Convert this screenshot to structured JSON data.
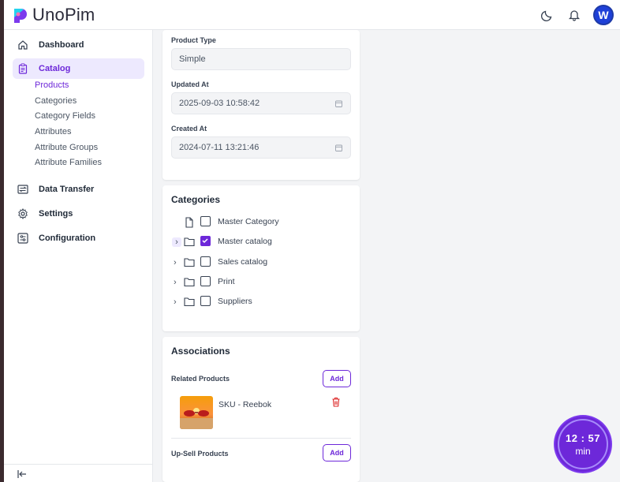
{
  "app": {
    "name": "UnoPim"
  },
  "header": {
    "avatar_letter": "W",
    "avatar_color": "#1e40d8"
  },
  "sidebar": {
    "items": [
      {
        "label": "Dashboard",
        "icon": "home-icon"
      },
      {
        "label": "Catalog",
        "icon": "clipboard-icon",
        "active": true
      },
      {
        "label": "Data Transfer",
        "icon": "transfer-icon"
      },
      {
        "label": "Settings",
        "icon": "gear-icon"
      },
      {
        "label": "Configuration",
        "icon": "sliders-icon"
      }
    ],
    "catalog_sub": [
      "Products",
      "Categories",
      "Category Fields",
      "Attributes",
      "Attribute Groups",
      "Attribute Families"
    ],
    "active_sub": "Products"
  },
  "general": {
    "product_type_label": "Product Type",
    "product_type_value": "Simple",
    "updated_at_label": "Updated At",
    "updated_at_value": "2025-09-03 10:58:42",
    "created_at_label": "Created At",
    "created_at_value": "2024-07-11 13:21:46"
  },
  "categories": {
    "title": "Categories",
    "items": [
      {
        "label": "Master Category",
        "type": "file",
        "expandable": false,
        "checked": false
      },
      {
        "label": "Master catalog",
        "type": "folder",
        "expandable": true,
        "checked": true
      },
      {
        "label": "Sales catalog",
        "type": "folder",
        "expandable": true,
        "checked": false
      },
      {
        "label": "Print",
        "type": "folder",
        "expandable": true,
        "checked": false
      },
      {
        "label": "Suppliers",
        "type": "folder",
        "expandable": true,
        "checked": false
      }
    ]
  },
  "associations": {
    "title": "Associations",
    "related_label": "Related Products",
    "upsell_label": "Up-Sell Products",
    "add_label": "Add",
    "related_product": "SKU - Reebok"
  },
  "timer": {
    "time": "12 : 57",
    "unit": "min"
  },
  "colors": {
    "accent": "#6d28d9",
    "accent_light": "#ede9fe"
  }
}
